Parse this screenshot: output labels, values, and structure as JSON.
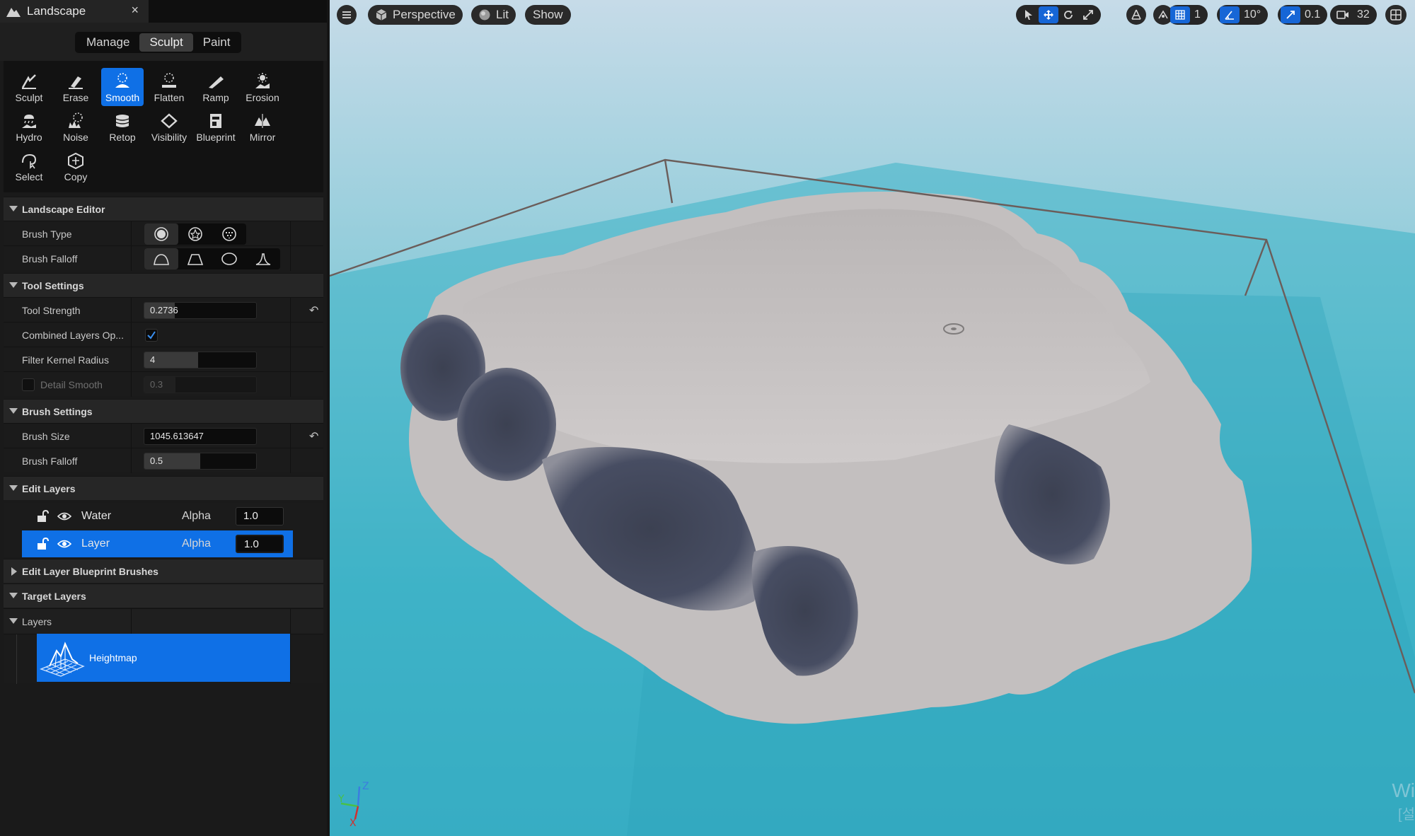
{
  "tab": {
    "title": "Landscape",
    "close": "×"
  },
  "modes": [
    "Manage",
    "Sculpt",
    "Paint"
  ],
  "tools": [
    {
      "label": "Sculpt",
      "icon": "sculpt-icon"
    },
    {
      "label": "Erase",
      "icon": "erase-icon"
    },
    {
      "label": "Smooth",
      "icon": "smooth-icon"
    },
    {
      "label": "Flatten",
      "icon": "flatten-icon"
    },
    {
      "label": "Ramp",
      "icon": "ramp-icon"
    },
    {
      "label": "Erosion",
      "icon": "erosion-icon"
    },
    {
      "label": "Hydro",
      "icon": "hydro-icon"
    },
    {
      "label": "Noise",
      "icon": "noise-icon"
    },
    {
      "label": "Retop",
      "icon": "retop-icon"
    },
    {
      "label": "Visibility",
      "icon": "visibility-icon"
    },
    {
      "label": "Blueprint",
      "icon": "blueprint-icon"
    },
    {
      "label": "Mirror",
      "icon": "mirror-icon"
    },
    {
      "label": "Select",
      "icon": "select-icon"
    },
    {
      "label": "Copy",
      "icon": "copy-icon"
    }
  ],
  "sections": {
    "landscape_editor": "Landscape Editor",
    "tool_settings": "Tool Settings",
    "brush_settings": "Brush Settings",
    "edit_layers": "Edit Layers",
    "edit_layer_bp": "Edit Layer Blueprint Brushes",
    "target_layers": "Target Layers",
    "layers": "Layers"
  },
  "landscape_editor": {
    "brush_type_label": "Brush Type",
    "brush_falloff_label": "Brush Falloff"
  },
  "tool_settings": {
    "tool_strength_label": "Tool Strength",
    "tool_strength_value": "0.2736",
    "tool_strength_fraction": 0.2736,
    "combined_layers_label": "Combined Layers Op...",
    "filter_kernel_label": "Filter Kernel Radius",
    "filter_kernel_value": "4",
    "detail_smooth_label": "Detail Smooth",
    "detail_smooth_value": "0.3"
  },
  "brush_settings": {
    "brush_size_label": "Brush Size",
    "brush_size_value": "1045.613647",
    "brush_falloff_label": "Brush Falloff",
    "brush_falloff_value": "0.5",
    "brush_falloff_fraction": 0.5
  },
  "edit_layers": [
    {
      "name": "Water",
      "alpha_label": "Alpha",
      "alpha": "1.0",
      "selected": false
    },
    {
      "name": "Layer",
      "alpha_label": "Alpha",
      "alpha": "1.0",
      "selected": true
    }
  ],
  "target_layers": {
    "heightmap": "Heightmap"
  },
  "viewport": {
    "perspective": "Perspective",
    "lit": "Lit",
    "show": "Show",
    "grid_snap": "1",
    "rotation_snap": "10°",
    "scale_snap": "0.1",
    "camera_speed": "32",
    "watermark_line1": "Wi",
    "watermark_line2": "[설"
  },
  "colors": {
    "accent": "#0f70e6",
    "panel": "#1a1a1a",
    "water": "#3fb2c6",
    "terrain": "#c7c3c3"
  }
}
